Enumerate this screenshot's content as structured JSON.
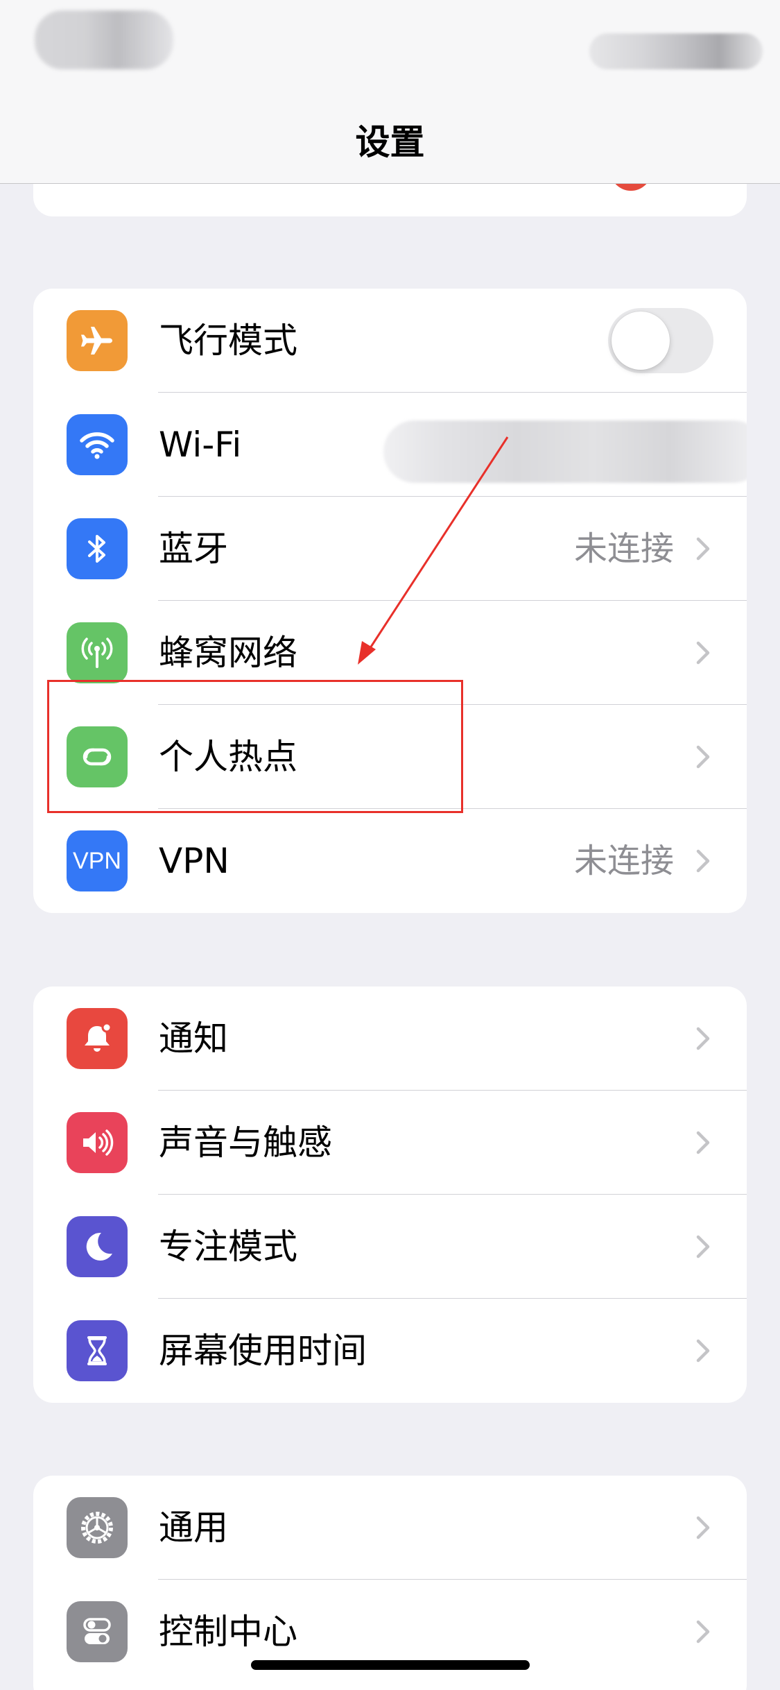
{
  "nav": {
    "title": "设置"
  },
  "group_connectivity": {
    "airplane": {
      "label": "飞行模式",
      "icon": "airplane-icon",
      "color": "#f19a37"
    },
    "wifi": {
      "label": "Wi-Fi",
      "icon": "wifi-icon",
      "color": "#3478f6"
    },
    "bluetooth": {
      "label": "蓝牙",
      "value": "未连接",
      "icon": "bluetooth-icon",
      "color": "#3478f6"
    },
    "cellular": {
      "label": "蜂窝网络",
      "icon": "cellular-antenna-icon",
      "color": "#65c466"
    },
    "hotspot": {
      "label": "个人热点",
      "icon": "hotspot-link-icon",
      "color": "#65c466"
    },
    "vpn": {
      "label": "VPN",
      "value": "未连接",
      "icon_text": "VPN",
      "color": "#3478f6"
    }
  },
  "group_notifications": {
    "notifications": {
      "label": "通知",
      "icon": "bell-badge-icon",
      "color": "#e8483f"
    },
    "sounds": {
      "label": "声音与触感",
      "icon": "speaker-icon",
      "color": "#e9435a"
    },
    "focus": {
      "label": "专注模式",
      "icon": "moon-icon",
      "color": "#5a54d0"
    },
    "screen_time": {
      "label": "屏幕使用时间",
      "icon": "hourglass-icon",
      "color": "#5a54d0"
    }
  },
  "group_general": {
    "general": {
      "label": "通用",
      "icon": "gear-icon",
      "color": "#8e8e93"
    },
    "control_center": {
      "label": "控制中心",
      "icon": "switches-icon",
      "color": "#8e8e93"
    }
  }
}
